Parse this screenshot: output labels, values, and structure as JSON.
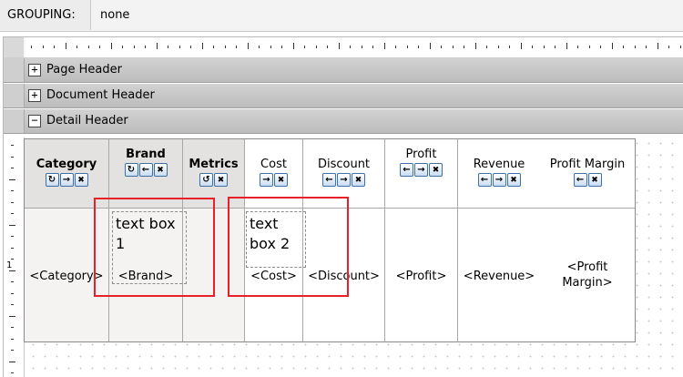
{
  "grouping": {
    "label": "GROUPING:",
    "value": "none"
  },
  "bands": {
    "page_header": {
      "toggle": "+",
      "label": "Page Header"
    },
    "document_header": {
      "toggle": "+",
      "label": "Document Header"
    },
    "detail_header": {
      "toggle": "−",
      "label": "Detail Header"
    }
  },
  "vruler": {
    "label": "1"
  },
  "columns": [
    {
      "title": "Category",
      "icons": [
        "↻",
        "→",
        "✖"
      ],
      "cell": "<Category>"
    },
    {
      "title": "Brand",
      "icons": [
        "↻",
        "←",
        "✖"
      ],
      "cell": "<Brand>"
    },
    {
      "title": "Metrics",
      "icons": [
        "↺",
        "✖"
      ],
      "cell": ""
    },
    {
      "title": "Cost",
      "icons": [
        "→",
        "✖"
      ],
      "cell": "<Cost>"
    },
    {
      "title": "Discount",
      "icons": [
        "←",
        "→",
        "✖"
      ],
      "cell": "<Discount>"
    },
    {
      "title": "Profit",
      "icons": [
        "←",
        "→",
        "✖"
      ],
      "cell": "<Profit>"
    },
    {
      "title": "Revenue",
      "icons": [
        "←",
        "→",
        "✖"
      ],
      "cell": "<Revenue>"
    },
    {
      "title": "Profit Margin",
      "icons": [
        "←",
        "✖"
      ],
      "cell_line1": "<Profit",
      "cell_line2": "Margin>"
    }
  ],
  "textboxes": [
    {
      "line1": "text box",
      "line2": "1"
    },
    {
      "line1": "text",
      "line2": "box 2"
    }
  ],
  "colors": {
    "highlight": "#e8202a",
    "button_border": "#3d6fa8"
  }
}
